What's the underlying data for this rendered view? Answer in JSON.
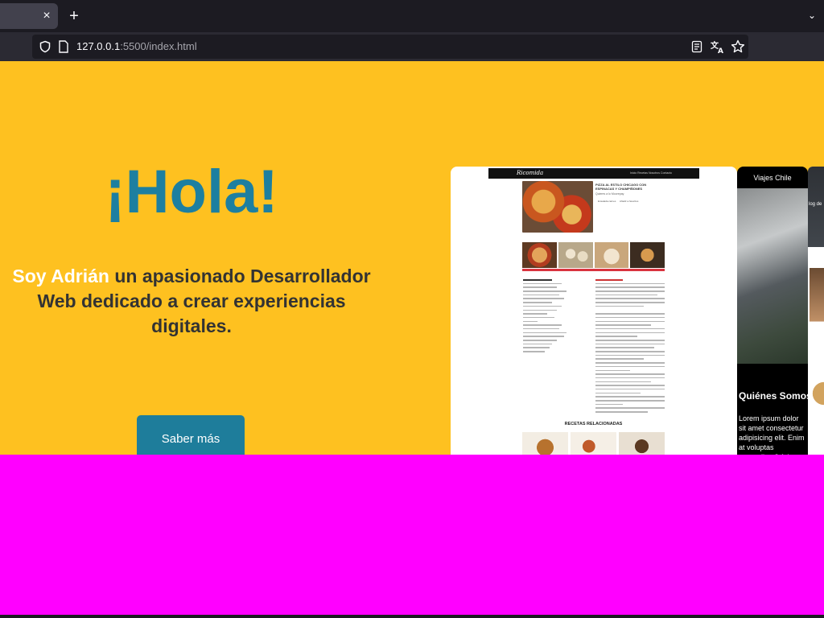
{
  "browser": {
    "tab_close": "×",
    "new_tab": "+",
    "tab_list": "⌄",
    "url_host": "127.0.0.1",
    "url_rest": ":5500/index.html",
    "icons": [
      "shield-icon",
      "page-icon",
      "reader-view-icon",
      "translate-icon",
      "bookmark-star-icon"
    ]
  },
  "hero": {
    "greeting": "¡Hola!",
    "name": "Soy Adrián",
    "tagline": " un apasionado Desarrollador Web dedicado a crear experiencias digitales.",
    "cta_label": "Saber más"
  },
  "projects": {
    "recipe_site": {
      "logo": "Ricomida",
      "nav": "Inicio  Recetas  Nosotros  Contacto",
      "recipe_title": "PIZZA AL ESTILO CHICAGO CON ESPINACAS Y CHAMPIÑONES",
      "recipe_sub": "Quieres a lo Moorepay",
      "tag_1": "Ensalada carnes",
      "tag_2": "Añadir a favoritos",
      "related_heading": "RECETAS RELACIONADAS"
    },
    "travel_site": {
      "title": "Viajes Chile",
      "heading": "Quiénes Somos",
      "body": "Lorem ipsum dolor sit amet consectetur adipisicing elit. Enim at voluptas temporibus? Ad"
    },
    "blog_site": {
      "label": "log de"
    }
  },
  "colors": {
    "background": "#fec120",
    "greeting": "#1d7fa0",
    "button": "#1e7d9b",
    "overlay": "#ff00ff"
  }
}
